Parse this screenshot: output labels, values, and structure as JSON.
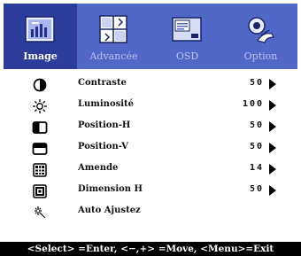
{
  "tabs": [
    {
      "label": "Image",
      "icon": "image-icon",
      "active": true
    },
    {
      "label": "Advancée",
      "icon": "advanced-icon",
      "active": false
    },
    {
      "label": "OSD",
      "icon": "osd-icon",
      "active": false
    },
    {
      "label": "Option",
      "icon": "option-hand-icon",
      "active": false
    }
  ],
  "items": [
    {
      "label": "Contraste",
      "value": "50",
      "icon": "contrast-icon"
    },
    {
      "label": "Luminosité",
      "value": "100",
      "icon": "brightness-icon"
    },
    {
      "label": "Position-H",
      "value": "50",
      "icon": "h-position-icon"
    },
    {
      "label": "Position-V",
      "value": "50",
      "icon": "v-position-icon"
    },
    {
      "label": "Amende",
      "value": "14",
      "icon": "fine-tune-icon"
    },
    {
      "label": "Dimension H",
      "value": "50",
      "icon": "h-size-icon"
    },
    {
      "label": "Auto Ajustez",
      "value": "",
      "icon": "auto-adjust-icon"
    }
  ],
  "status_bar": "<Select> =Enter, <−,+> =Move, <Menu>=Exit",
  "colors": {
    "tab_bar": "#5068c8",
    "tab_active": "#2c3d9c",
    "status_bg": "#000000",
    "status_text": "#ffffff"
  }
}
